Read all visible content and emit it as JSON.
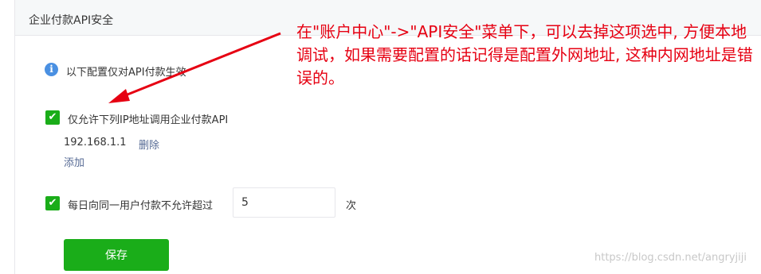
{
  "panel": {
    "title": "企业付款API安全"
  },
  "info": {
    "text": "以下配置仅对API付款生效"
  },
  "ip_restriction": {
    "checked": true,
    "label": "仅允许下列IP地址调用企业付款API",
    "ips": [
      "192.168.1.1"
    ],
    "delete_label": "删除",
    "add_label": "添加"
  },
  "daily_limit": {
    "checked": true,
    "label": "每日向同一用户付款不允许超过",
    "value": "5",
    "unit": "次"
  },
  "save_label": "保存",
  "annotation": {
    "text": "在\"账户中心\"->\"API安全\"菜单下，可以去掉这项选中, 方便本地调试，如果需要配置的话记得是配置外网地址, 这种内网地址是错误的。",
    "color": "#e60012"
  },
  "watermark": "https://blog.csdn.net/angryjiji",
  "colors": {
    "accent_green": "#1aad19",
    "link_blue": "#576b95",
    "info_blue": "#4a90e2"
  },
  "icons": {
    "info": "info-icon",
    "check": "check-icon",
    "arrow": "arrow-icon"
  }
}
